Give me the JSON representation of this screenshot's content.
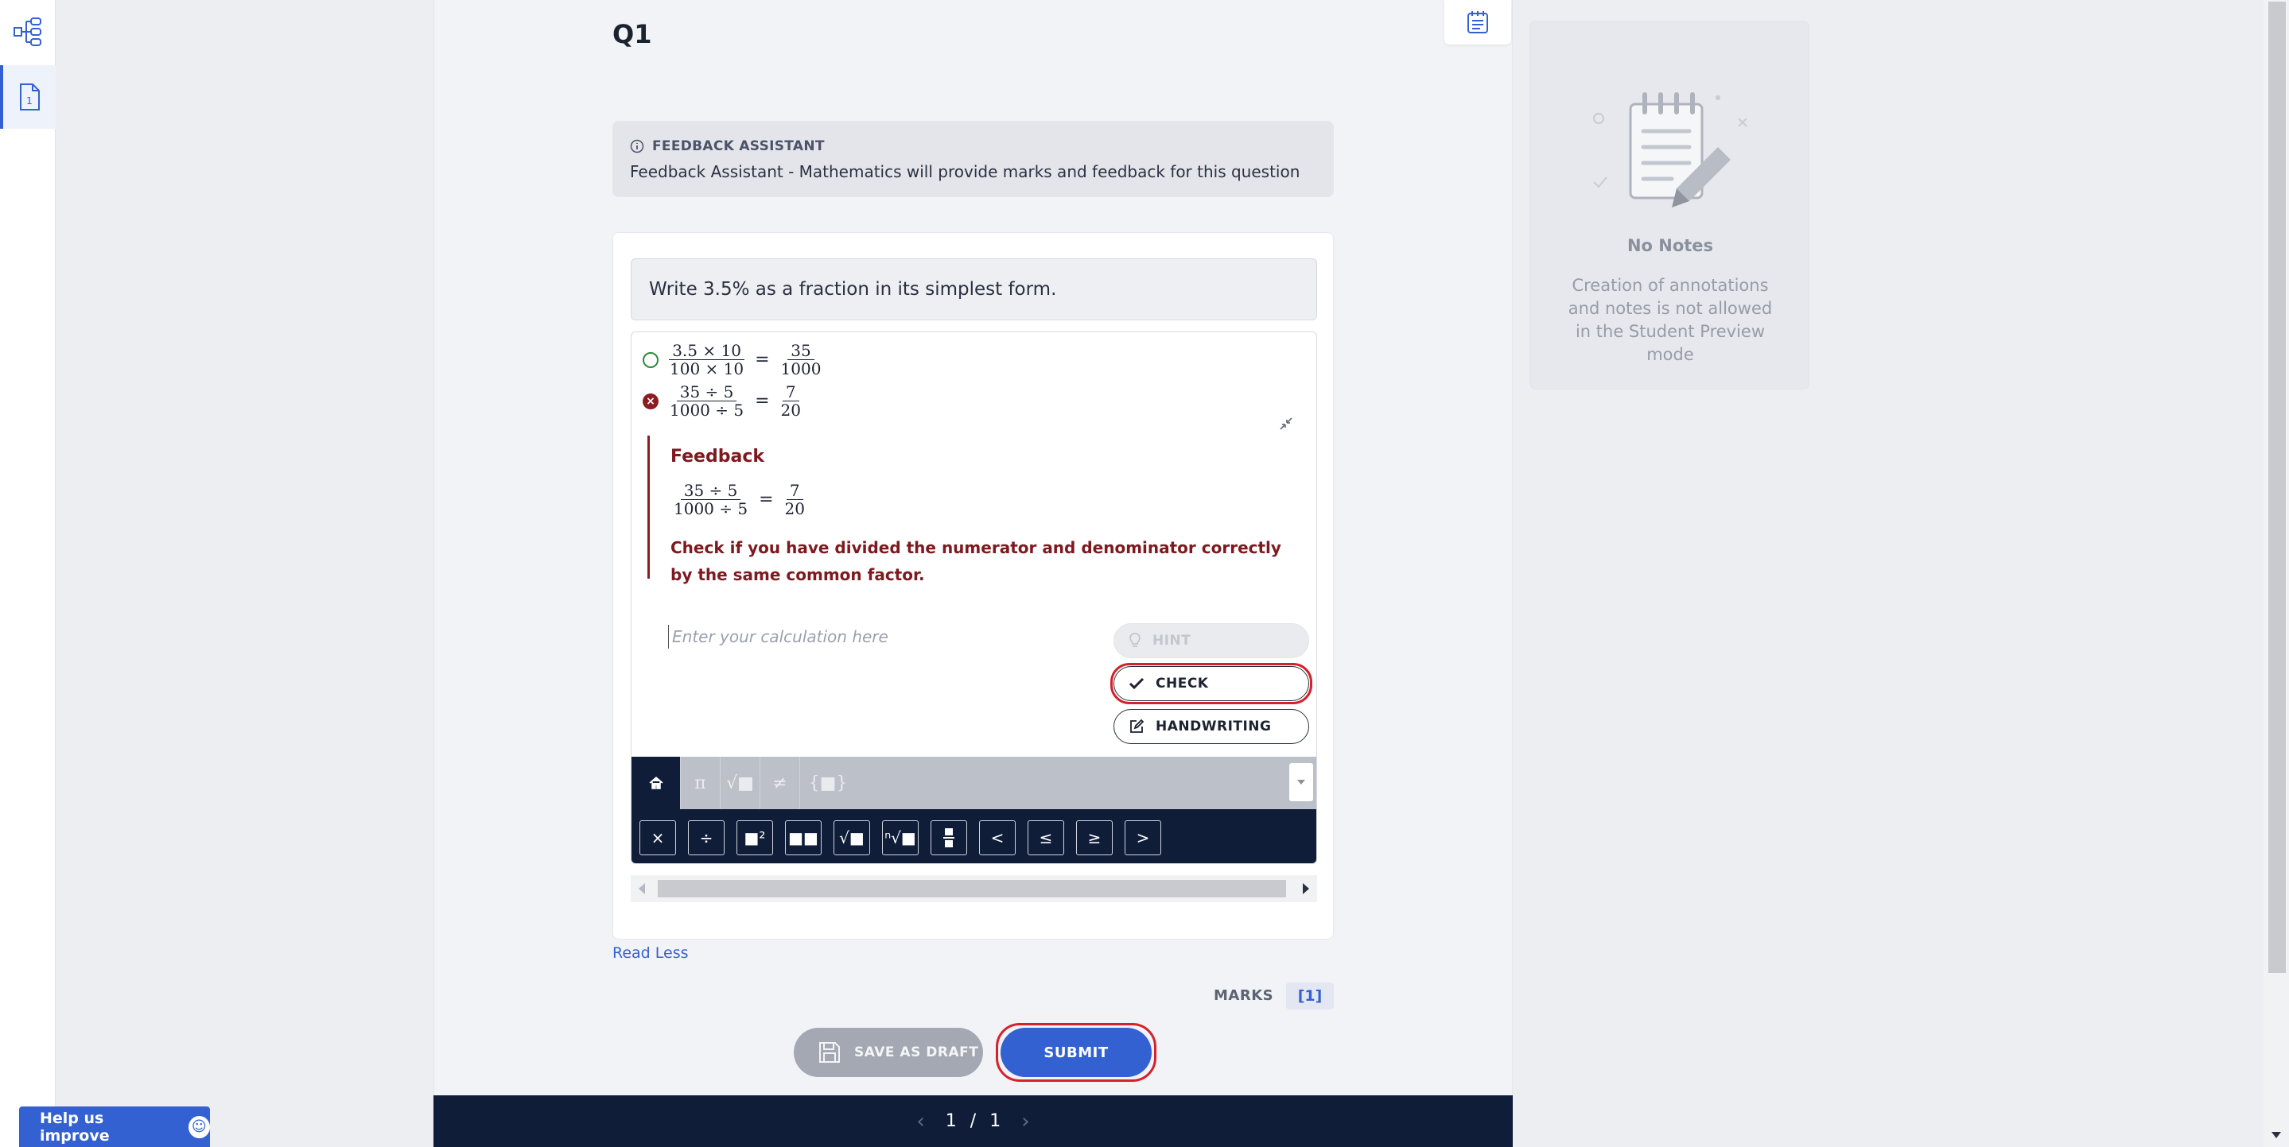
{
  "question": {
    "title": "Q1",
    "prompt": "Write 3.5% as a fraction in its simplest form."
  },
  "feedback_assistant": {
    "heading": "FEEDBACK ASSISTANT",
    "description": "Feedback Assistant - Mathematics will provide marks and feedback for this question"
  },
  "work": {
    "line1": {
      "status": "correct",
      "lhs_num": "3.5 × 10",
      "lhs_den": "100 × 10",
      "eq": "=",
      "rhs_num": "35",
      "rhs_den": "1000"
    },
    "line2": {
      "status": "incorrect",
      "lhs_num": "35 ÷ 5",
      "lhs_den": "1000 ÷ 5",
      "eq": "=",
      "rhs_num": "7",
      "rhs_den": "20"
    },
    "feedback": {
      "title": "Feedback",
      "lhs_num": "35 ÷ 5",
      "lhs_den": "1000 ÷ 5",
      "eq": "=",
      "rhs_num": "7",
      "rhs_den": "20",
      "message": "Check if you have divided the numerator and denominator correctly by the same common factor."
    },
    "input_placeholder": "Enter your calculation here",
    "buttons": {
      "hint": "HINT",
      "check": "CHECK",
      "handwriting": "HANDWRITING"
    }
  },
  "keyboard": {
    "tabs": [
      "π",
      "√■",
      "≠",
      "{■}"
    ],
    "keys": [
      "×",
      "÷",
      "■²",
      "■■",
      "√■",
      "ⁿ√■",
      "▪",
      "<",
      "≤",
      "≥",
      ">"
    ]
  },
  "footer": {
    "read_less": "Read Less",
    "marks_label": "MARKS",
    "marks_value": "[1]",
    "save_draft": "SAVE AS DRAFT",
    "submit": "SUBMIT"
  },
  "pager": {
    "current": "1",
    "separator": "/",
    "total": "1"
  },
  "notes": {
    "title": "No Notes",
    "message": "Creation of annotations and notes is not allowed in the Student Preview mode"
  },
  "help": {
    "label": "Help us improve"
  },
  "highlight_color": "#d6202a",
  "accent_color": "#3461d1",
  "navy_color": "#0f1d38"
}
